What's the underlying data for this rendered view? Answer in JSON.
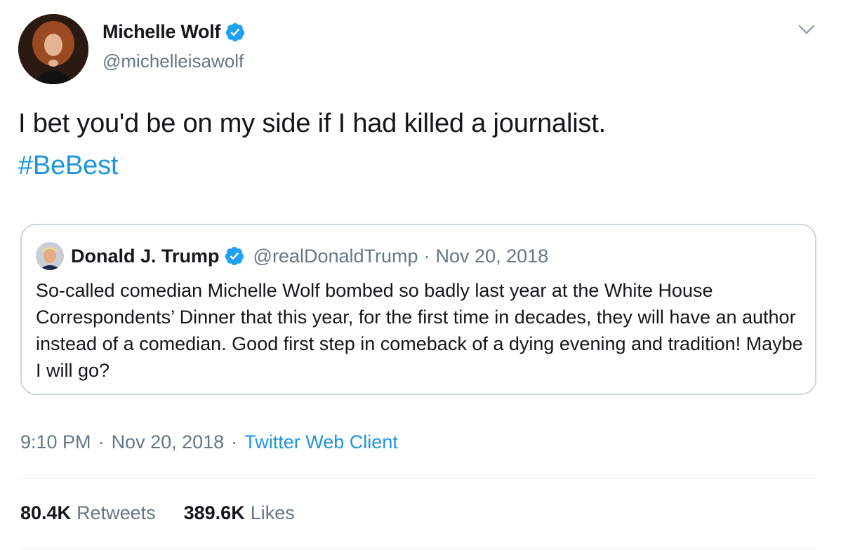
{
  "author": {
    "display_name": "Michelle Wolf",
    "handle": "@michelleisawolf",
    "verified": true
  },
  "tweet": {
    "text": "I bet you'd be on my side if I had killed a journalist.",
    "hashtag": "#BeBest"
  },
  "quoted_tweet": {
    "display_name": "Donald J. Trump",
    "handle": "@realDonaldTrump",
    "separator": "·",
    "date": "Nov 20, 2018",
    "text": "So-called comedian Michelle Wolf bombed so badly last year at the White House Correspondents’ Dinner that this year, for the first time in decades, they will have an author instead of a comedian. Good first step in comeback of a dying evening and tradition! Maybe I will go?"
  },
  "meta": {
    "time": "9:10 PM",
    "separator": "·",
    "date": "Nov 20, 2018",
    "source": "Twitter Web Client"
  },
  "stats": {
    "retweets_count": "80.4K",
    "retweets_label": "Retweets",
    "likes_count": "389.6K",
    "likes_label": "Likes"
  },
  "colors": {
    "link": "#1b95e0",
    "secondary_text": "#657786",
    "primary_text": "#14171a",
    "border": "#ccd6dd",
    "verified_badge": "#1da1f2"
  },
  "icons": {
    "verified": "verified-badge-icon",
    "caret": "chevron-down-icon"
  }
}
